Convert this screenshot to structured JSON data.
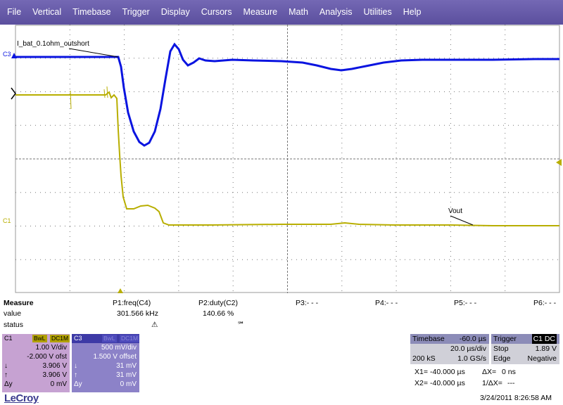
{
  "menu": [
    "File",
    "Vertical",
    "Timebase",
    "Trigger",
    "Display",
    "Cursors",
    "Measure",
    "Math",
    "Analysis",
    "Utilities",
    "Help"
  ],
  "colors": {
    "menubar": "#6a5fae",
    "c3_trace": "#0a14e0",
    "c1_trace": "#b8ae00",
    "grid_dot": "#888888"
  },
  "screen": {
    "trace_label": "I_bat_0.1ohm_outshort",
    "vout_label": "Vout",
    "c3_marker": "C3",
    "c1_marker": "C1"
  },
  "measure": {
    "title": "Measure",
    "row_labels": [
      "value",
      "status"
    ],
    "params": [
      {
        "name": "P1:freq(C4)",
        "value": "301.566 kHz",
        "status": "⚠"
      },
      {
        "name": "P2:duty(C2)",
        "value": "140.66 %",
        "status": "℠"
      },
      {
        "name": "P3:- - -",
        "value": "",
        "status": ""
      },
      {
        "name": "P4:- - -",
        "value": "",
        "status": ""
      },
      {
        "name": "P5:- - -",
        "value": "",
        "status": ""
      },
      {
        "name": "P6:- - -",
        "value": "",
        "status": ""
      }
    ]
  },
  "c1": {
    "name": "C1",
    "bwl": "BwL",
    "coupling": "DC1M",
    "vdiv": "1.00 V/div",
    "offset": "-2.000 V ofst",
    "down": "3.906 V",
    "up": "3.906 V",
    "dy": "0 mV",
    "down_label": "↓",
    "up_label": "↑",
    "dy_label": "Δy"
  },
  "c3": {
    "name": "C3",
    "bwl": "BwL",
    "coupling": "DC1M",
    "vdiv": "500 mV/div",
    "offset": "1.500 V offset",
    "down": "31 mV",
    "up": "31 mV",
    "dy": "0 mV",
    "down_label": "↓",
    "up_label": "↑",
    "dy_label": "Δy"
  },
  "timebase": {
    "title": "Timebase",
    "delay": "-60.0 µs",
    "tdiv": "20.0 µs/div",
    "samples": "200 kS",
    "rate": "1.0 GS/s"
  },
  "trigger": {
    "title": "Trigger",
    "channel": "C1",
    "coupling": "DC",
    "mode": "Stop",
    "level": "1.89 V",
    "type": "Edge",
    "slope": "Negative"
  },
  "cursors": {
    "x1_label": "X1=",
    "x1": "-40.000 µs",
    "dx_label": "ΔX=",
    "dx": "0 ns",
    "x2_label": "X2=",
    "x2": "-40.000 µs",
    "inv_dx_label": "1/ΔX=",
    "inv_dx": "---"
  },
  "footer": {
    "logo": "LeCroy",
    "datetime": "3/24/2011 8:26:58 AM"
  }
}
